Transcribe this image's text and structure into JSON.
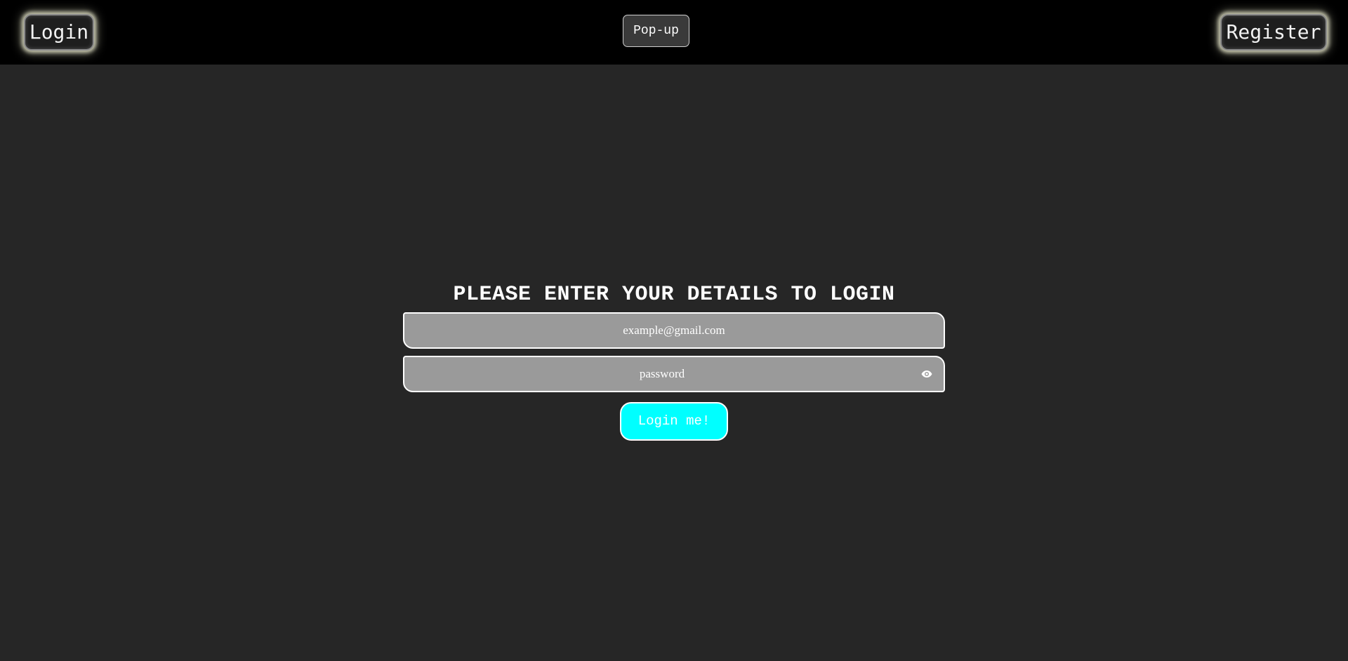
{
  "header": {
    "login_label": "Login",
    "popup_label": "Pop-up",
    "register_label": "Register"
  },
  "form": {
    "heading": "PLEASE ENTER YOUR DETAILS TO LOGIN",
    "email_placeholder": "example@gmail.com",
    "password_placeholder": "password",
    "password_toggle_icon": "eye-icon",
    "submit_label": "Login me!"
  },
  "colors": {
    "topbar": "#000000",
    "page_background": "#262626",
    "field_background": "#9a9a9a",
    "submit_accent": "#00ffff"
  }
}
